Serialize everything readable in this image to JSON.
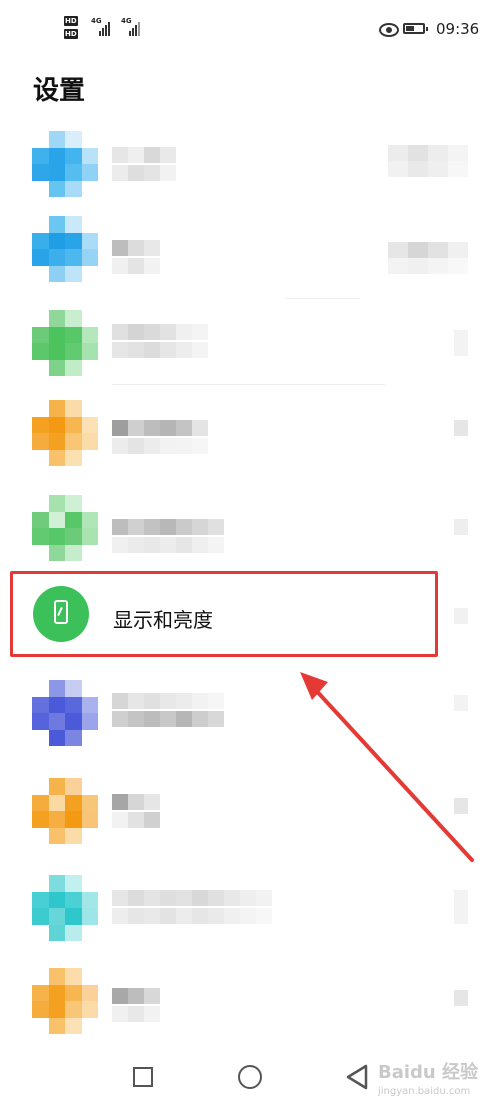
{
  "status_bar": {
    "hd_label": "HD",
    "network": "4G",
    "time": "09:36",
    "icons": [
      "signal-icon",
      "eye-icon",
      "battery-icon"
    ]
  },
  "header": {
    "title": "设置"
  },
  "highlighted_item": {
    "label": "显示和亮度",
    "icon": "phone-brightness-icon",
    "icon_color": "#3cc15a",
    "highlight_color": "#e53935"
  },
  "colors": {
    "blue": "#2aa4e8",
    "green": "#4cc35c",
    "orange": "#f4a021",
    "indigo": "#4a5ad8",
    "cyan": "#2ec8cc",
    "annotation_arrow": "#e53935"
  },
  "nav_bar": {
    "icons": [
      "recent-apps-icon",
      "home-icon",
      "back-icon"
    ]
  },
  "watermark": {
    "text": "Baidu 经验",
    "sub": "jingyan.baidu.com"
  }
}
